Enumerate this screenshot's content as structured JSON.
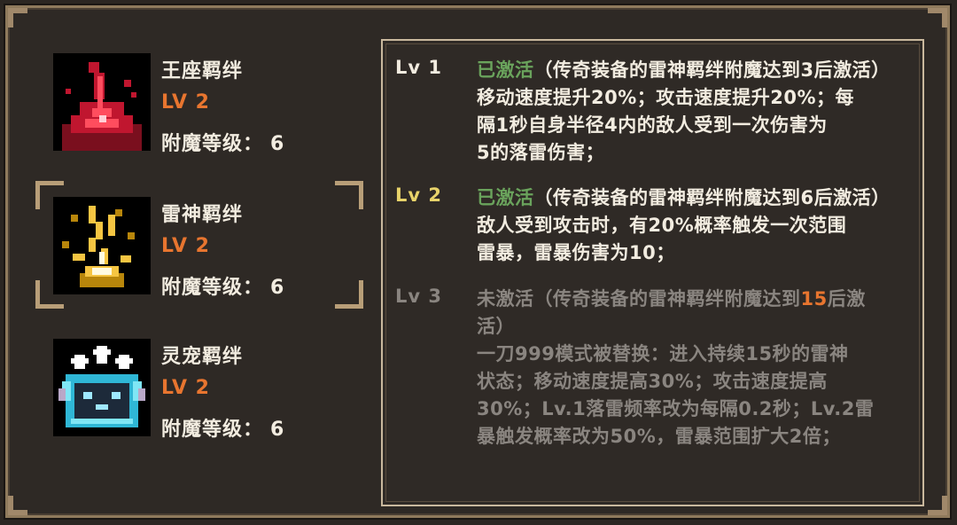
{
  "bonds": [
    {
      "name": "王座羁绊",
      "level": "LV 2",
      "enchant_label": "附魔等级：",
      "enchant_value": "6",
      "icon": "throne-bond-icon"
    },
    {
      "name": "雷神羁绊",
      "level": "LV 2",
      "enchant_label": "附魔等级：",
      "enchant_value": "6",
      "icon": "thunder-bond-icon"
    },
    {
      "name": "灵宠羁绊",
      "level": "LV 2",
      "enchant_label": "附魔等级：",
      "enchant_value": "6",
      "icon": "pet-bond-icon"
    }
  ],
  "detail": {
    "levels": [
      {
        "tag": "Lv 1",
        "status": "已激活",
        "condition": "（传奇装备的雷神羁绊附魔达到3后激活）",
        "description_lines": [
          "移动速度提升20%；攻击速度提升20%；每",
          "隔1秒自身半径4内的敌人受到一次伤害为",
          "5的落雷伤害；"
        ]
      },
      {
        "tag": "Lv 2",
        "status": "已激活",
        "condition": "（传奇装备的雷神羁绊附魔达到6后激活）",
        "description_lines": [
          "敌人受到攻击时，有20%概率触发一次范围",
          "雷暴，雷暴伤害为10；"
        ]
      },
      {
        "tag": "Lv 3",
        "status": "未激活",
        "condition_prefix": "（传奇装备的雷神羁绊附魔达到",
        "condition_highlight": "15",
        "condition_suffix": "后激",
        "condition_line2": "活）",
        "description_lines": [
          "一刀999模式被替换：进入持续15秒的雷神",
          "状态；移动速度提高30%；攻击速度提高",
          "30%；Lv.1落雷频率改为每隔0.2秒；Lv.2雷",
          "暴触发概率改为50%，雷暴范围扩大2倍；"
        ]
      }
    ]
  },
  "colors": {
    "active_status": "#6aa35c",
    "inactive": "#8a8580",
    "level_orange": "#e8752f",
    "lv1_tag": "#f2ece0",
    "lv2_tag": "#e8d36a",
    "text": "#f2ece0"
  }
}
